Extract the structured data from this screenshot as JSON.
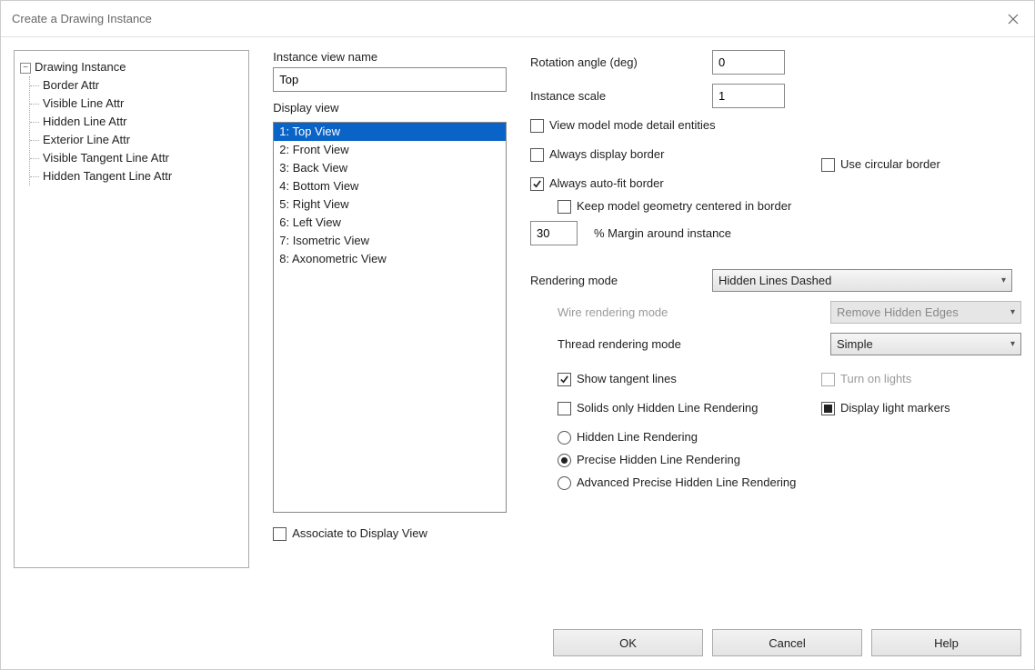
{
  "title": "Create a Drawing Instance",
  "tree": {
    "root": "Drawing Instance",
    "children": [
      "Border Attr",
      "Visible Line Attr",
      "Hidden Line Attr",
      "Exterior Line Attr",
      "Visible Tangent Line Attr",
      "Hidden Tangent Line Attr"
    ]
  },
  "instance_view_name_label": "Instance view name",
  "instance_view_name_value": "Top",
  "display_view_label": "Display view",
  "display_views": [
    "1: Top View",
    "2: Front View",
    "3: Back View",
    "4: Bottom View",
    "5: Right View",
    "6: Left View",
    "7: Isometric View",
    "8: Axonometric View"
  ],
  "display_view_selected_index": 0,
  "associate_to_display_view": "Associate to Display View",
  "rotation_angle_label": "Rotation angle (deg)",
  "rotation_angle_value": "0",
  "instance_scale_label": "Instance scale",
  "instance_scale_value": "1",
  "view_model_mode_detail": "View model mode detail entities",
  "always_display_border": "Always display border",
  "use_circular_border": "Use circular border",
  "always_autofit_border": "Always auto-fit border",
  "keep_model_geometry_centered": "Keep model geometry centered in border",
  "margin_value": "30",
  "margin_label": "% Margin around instance",
  "rendering_mode_label": "Rendering mode",
  "rendering_mode_value": "Hidden Lines Dashed",
  "wire_rendering_mode_label": "Wire rendering mode",
  "wire_rendering_mode_value": "Remove Hidden Edges",
  "thread_rendering_mode_label": "Thread rendering mode",
  "thread_rendering_mode_value": "Simple",
  "show_tangent_lines": "Show tangent lines",
  "turn_on_lights": "Turn on lights",
  "solids_only_hlr": "Solids only Hidden Line Rendering",
  "display_light_markers": "Display light markers",
  "radio_hlr": "Hidden Line Rendering",
  "radio_phlr": "Precise Hidden Line Rendering",
  "radio_aphlr": "Advanced Precise Hidden Line Rendering",
  "buttons": {
    "ok": "OK",
    "cancel": "Cancel",
    "help": "Help"
  }
}
